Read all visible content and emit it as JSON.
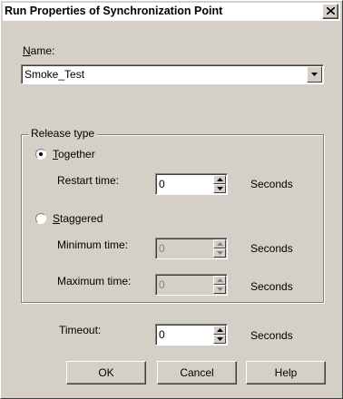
{
  "window": {
    "title": "Run Properties of Synchronization Point",
    "close_icon": "close-icon"
  },
  "name_field": {
    "label_accel": "N",
    "label_rest": "ame:",
    "value": "Smoke_Test"
  },
  "release": {
    "group_label": "Release type",
    "together": {
      "accel": "T",
      "rest": "ogether",
      "selected": true,
      "restart_label": "Restart time:",
      "restart_value": "0",
      "restart_units": "Seconds"
    },
    "staggered": {
      "accel": "S",
      "rest": "taggered",
      "selected": false,
      "min_label": "Minimum time:",
      "min_value": "0",
      "min_units": "Seconds",
      "max_label": "Maximum time:",
      "max_value": "0",
      "max_units": "Seconds"
    }
  },
  "timeout": {
    "label": "Timeout:",
    "value": "0",
    "units": "Seconds"
  },
  "buttons": {
    "ok": "OK",
    "cancel": "Cancel",
    "help": "Help"
  },
  "colors": {
    "dialog_face": "#d4d0c8",
    "title_bg": "#ffffff"
  }
}
